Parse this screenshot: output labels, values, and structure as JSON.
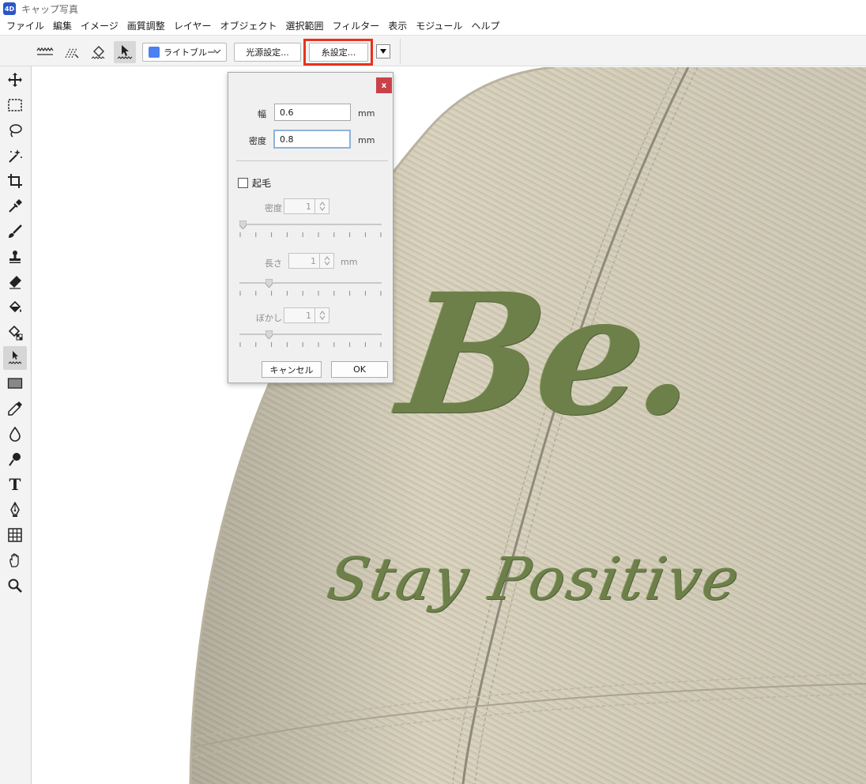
{
  "app": {
    "logo_text": "4D",
    "title": "キャップ写真"
  },
  "menu": [
    "ファイル",
    "編集",
    "イメージ",
    "画質調整",
    "レイヤー",
    "オブジェクト",
    "選択範囲",
    "フィルター",
    "表示",
    "モジュール",
    "ヘルプ"
  ],
  "toolbar": {
    "mode_icons": [
      "stitch-wave-icon",
      "stitch-pen-icon",
      "stitch-fill-icon",
      "stitch-select-icon"
    ],
    "active_mode": "stitch-select-icon",
    "thread_color_label": "ライトブルー",
    "thread_color": "#4a80f0",
    "light_settings_label": "光源設定...",
    "thread_settings_label": "糸設定...",
    "highlight_color": "#e8321d"
  },
  "tools": [
    "move-icon",
    "marquee-icon",
    "lasso-icon",
    "magic-wand-icon",
    "crop-icon",
    "eyedropper-icon",
    "brush-icon",
    "stamp-icon",
    "eraser-icon",
    "paint-bucket-icon",
    "pattern-bucket-icon",
    "stitch-tool-icon",
    "rectangle-icon",
    "pen-edit-icon",
    "drop-icon",
    "smudge-icon",
    "text-icon",
    "pen-icon",
    "grid-icon",
    "hand-icon",
    "zoom-icon"
  ],
  "active_tool": "stitch-tool-icon",
  "canvas": {
    "embroidery_large": "Be.",
    "embroidery_small": "Stay Positive",
    "cap_color": "#d5cfbb",
    "thread_color": "#6d8049"
  },
  "dialog": {
    "close_label": "x",
    "width_label": "幅",
    "width_value": "0.6",
    "width_unit": "mm",
    "density_label": "密度",
    "density_value": "0.8",
    "density_unit": "mm",
    "fuzz_label": "起毛",
    "fuzz_checked": false,
    "fuzz_density_label": "密度",
    "fuzz_density_value": "1",
    "length_label": "長さ",
    "length_value": "1",
    "length_unit": "mm",
    "blur_label": "ぼかし",
    "blur_value": "1",
    "cancel_label": "キャンセル",
    "ok_label": "OK"
  }
}
